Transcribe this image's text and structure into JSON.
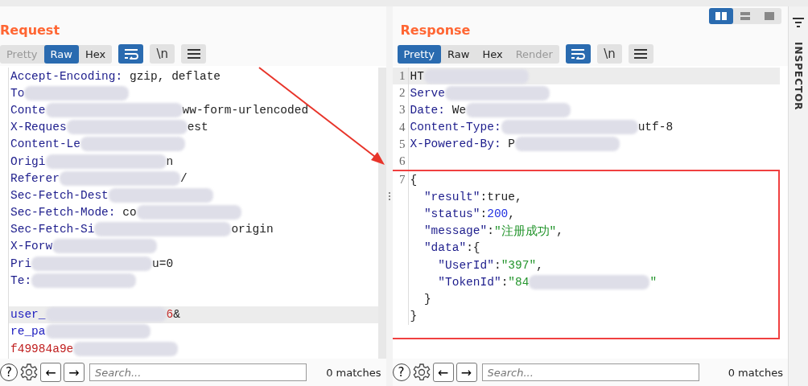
{
  "annotations": {
    "arrow": true
  },
  "request": {
    "title": "Request",
    "view_tabs": [
      {
        "label": "Pretty",
        "selected": false,
        "disabled": true
      },
      {
        "label": "Raw",
        "selected": true,
        "disabled": false
      },
      {
        "label": "Hex",
        "selected": false,
        "disabled": false
      }
    ],
    "tools": [
      {
        "kind": "wrap",
        "selected": true
      },
      {
        "kind": "newline",
        "label": "\\n",
        "selected": false
      },
      {
        "kind": "menu",
        "selected": false
      }
    ],
    "lines": [
      {
        "current": false,
        "parts": [
          {
            "kind": "name",
            "text": "Accept-Encoding:"
          },
          {
            "kind": "value",
            "text": " gzip, deflate"
          }
        ]
      },
      {
        "current": false,
        "parts": [
          {
            "kind": "name",
            "text": "To"
          },
          {
            "kind": "redacted"
          }
        ]
      },
      {
        "current": false,
        "parts": [
          {
            "kind": "name",
            "text": "Conte"
          },
          {
            "kind": "redacted"
          },
          {
            "kind": "value",
            "text": "ww-form-urlencoded"
          }
        ]
      },
      {
        "current": false,
        "parts": [
          {
            "kind": "name",
            "text": "X-Reques"
          },
          {
            "kind": "redacted"
          },
          {
            "kind": "value",
            "text": "est"
          }
        ]
      },
      {
        "current": false,
        "parts": [
          {
            "kind": "name",
            "text": "Content-Le"
          },
          {
            "kind": "redacted"
          }
        ]
      },
      {
        "current": false,
        "parts": [
          {
            "kind": "name",
            "text": "Origi"
          },
          {
            "kind": "redacted"
          },
          {
            "kind": "value",
            "text": "n"
          }
        ]
      },
      {
        "current": false,
        "parts": [
          {
            "kind": "name",
            "text": "Referer"
          },
          {
            "kind": "redacted"
          },
          {
            "kind": "value",
            "text": "/"
          }
        ]
      },
      {
        "current": false,
        "parts": [
          {
            "kind": "name",
            "text": "Sec-Fetch-Dest"
          },
          {
            "kind": "redacted"
          }
        ]
      },
      {
        "current": false,
        "parts": [
          {
            "kind": "name",
            "text": "Sec-Fetch-Mode:"
          },
          {
            "kind": "value",
            "text": " co"
          },
          {
            "kind": "redacted"
          }
        ]
      },
      {
        "current": false,
        "parts": [
          {
            "kind": "name",
            "text": "Sec-Fetch-Si"
          },
          {
            "kind": "redacted"
          },
          {
            "kind": "value",
            "text": "origin"
          }
        ]
      },
      {
        "current": false,
        "parts": [
          {
            "kind": "name",
            "text": "X-Forw"
          },
          {
            "kind": "redacted"
          }
        ]
      },
      {
        "current": false,
        "parts": [
          {
            "kind": "name",
            "text": "Pri"
          },
          {
            "kind": "redacted"
          },
          {
            "kind": "value",
            "text": "u=0"
          }
        ]
      },
      {
        "current": false,
        "parts": [
          {
            "kind": "name",
            "text": "Te:"
          },
          {
            "kind": "redacted"
          }
        ]
      },
      {
        "current": false
      },
      {
        "current": true,
        "parts": [
          {
            "kind": "param",
            "text": "user_"
          },
          {
            "kind": "redacted"
          },
          {
            "kind": "pval",
            "text": "6"
          },
          {
            "kind": "value",
            "text": "&"
          }
        ]
      },
      {
        "current": false,
        "parts": [
          {
            "kind": "param",
            "text": "re_pa"
          },
          {
            "kind": "redacted"
          }
        ]
      },
      {
        "current": false,
        "parts": [
          {
            "kind": "pval",
            "text": "f49984a9e"
          },
          {
            "kind": "redacted"
          }
        ]
      }
    ],
    "help": "?",
    "back": "←",
    "forward": "→",
    "search": {
      "placeholder": "Search..."
    },
    "matches": "0 matches"
  },
  "response": {
    "title": "Response",
    "layouts": [
      {
        "kind": "split",
        "selected": true
      },
      {
        "kind": "stacked",
        "selected": false
      },
      {
        "kind": "single",
        "selected": false
      }
    ],
    "view_tabs": [
      {
        "label": "Pretty",
        "selected": true,
        "disabled": false
      },
      {
        "label": "Raw",
        "selected": false,
        "disabled": false
      },
      {
        "label": "Hex",
        "selected": false,
        "disabled": false
      },
      {
        "label": "Render",
        "selected": false,
        "disabled": true
      }
    ],
    "tools": [
      {
        "kind": "wrap",
        "selected": true
      },
      {
        "kind": "newline",
        "label": "\\n",
        "selected": false
      },
      {
        "kind": "menu",
        "selected": false
      }
    ],
    "header_lines": [
      {
        "n": "1",
        "current": true,
        "parts": [
          {
            "kind": "value",
            "text": "HT"
          },
          {
            "kind": "redacted"
          }
        ]
      },
      {
        "n": "2",
        "current": false,
        "parts": [
          {
            "kind": "name",
            "text": "Serve"
          },
          {
            "kind": "redacted"
          }
        ]
      },
      {
        "n": "3",
        "current": false,
        "parts": [
          {
            "kind": "name",
            "text": "Date:"
          },
          {
            "kind": "value",
            "text": " We"
          },
          {
            "kind": "redacted"
          }
        ]
      },
      {
        "n": "4",
        "current": false,
        "parts": [
          {
            "kind": "name",
            "text": "Content-Type:"
          },
          {
            "kind": "redacted"
          },
          {
            "kind": "value",
            "text": "utf-8"
          }
        ]
      },
      {
        "n": "5",
        "current": false,
        "parts": [
          {
            "kind": "name",
            "text": "X-Powered-By:"
          },
          {
            "kind": "value",
            "text": " P"
          },
          {
            "kind": "redacted"
          }
        ]
      },
      {
        "n": "6",
        "current": false
      }
    ],
    "body_highlighted": true,
    "body_lines": [
      {
        "n": "7",
        "current": false,
        "parts": [
          {
            "kind": "value",
            "text": "{"
          }
        ]
      },
      {
        "current": false,
        "parts": [
          {
            "kind": "name",
            "text": "  \"result\""
          },
          {
            "kind": "value",
            "text": ":true,"
          }
        ]
      },
      {
        "current": false,
        "parts": [
          {
            "kind": "name",
            "text": "  \"status\""
          },
          {
            "kind": "value",
            "text": ":"
          },
          {
            "kind": "num",
            "text": "200"
          },
          {
            "kind": "value",
            "text": ","
          }
        ]
      },
      {
        "current": false,
        "parts": [
          {
            "kind": "name",
            "text": "  \"message\""
          },
          {
            "kind": "value",
            "text": ":"
          },
          {
            "kind": "str",
            "text": "\"注册成功\""
          },
          {
            "kind": "value",
            "text": ","
          }
        ]
      },
      {
        "current": false,
        "parts": [
          {
            "kind": "name",
            "text": "  \"data\""
          },
          {
            "kind": "value",
            "text": ":{"
          }
        ]
      },
      {
        "current": false,
        "parts": [
          {
            "kind": "name",
            "text": "    \"UserId\""
          },
          {
            "kind": "value",
            "text": ":"
          },
          {
            "kind": "str",
            "text": "\"397\""
          },
          {
            "kind": "value",
            "text": ","
          }
        ]
      },
      {
        "current": false,
        "parts": [
          {
            "kind": "name",
            "text": "    \"TokenId\""
          },
          {
            "kind": "value",
            "text": ":"
          },
          {
            "kind": "str",
            "text": "\"84"
          },
          {
            "kind": "redacted"
          },
          {
            "kind": "str",
            "text": "\""
          }
        ]
      },
      {
        "current": false,
        "parts": [
          {
            "kind": "value",
            "text": "  }"
          }
        ]
      },
      {
        "current": false,
        "parts": [
          {
            "kind": "value",
            "text": "}"
          }
        ]
      }
    ],
    "help": "?",
    "back": "←",
    "forward": "→",
    "search": {
      "placeholder": "Search..."
    },
    "matches": "0 matches"
  },
  "inspector": {
    "label": "INSPECTOR"
  }
}
